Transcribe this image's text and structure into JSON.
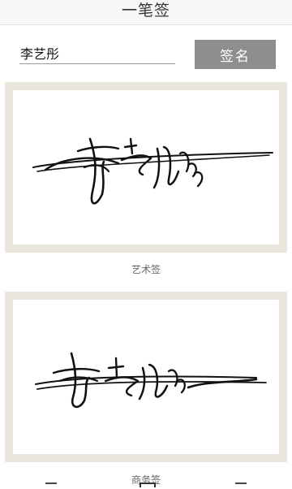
{
  "header": {
    "title": "一笔签"
  },
  "form": {
    "name_value": "李艺彤",
    "sign_label": "签名"
  },
  "signatures": [
    {
      "style_label": "艺术签"
    },
    {
      "style_label": "商务签"
    }
  ],
  "icons": [
    "home-icon",
    "signature-icon",
    "profile-icon"
  ]
}
